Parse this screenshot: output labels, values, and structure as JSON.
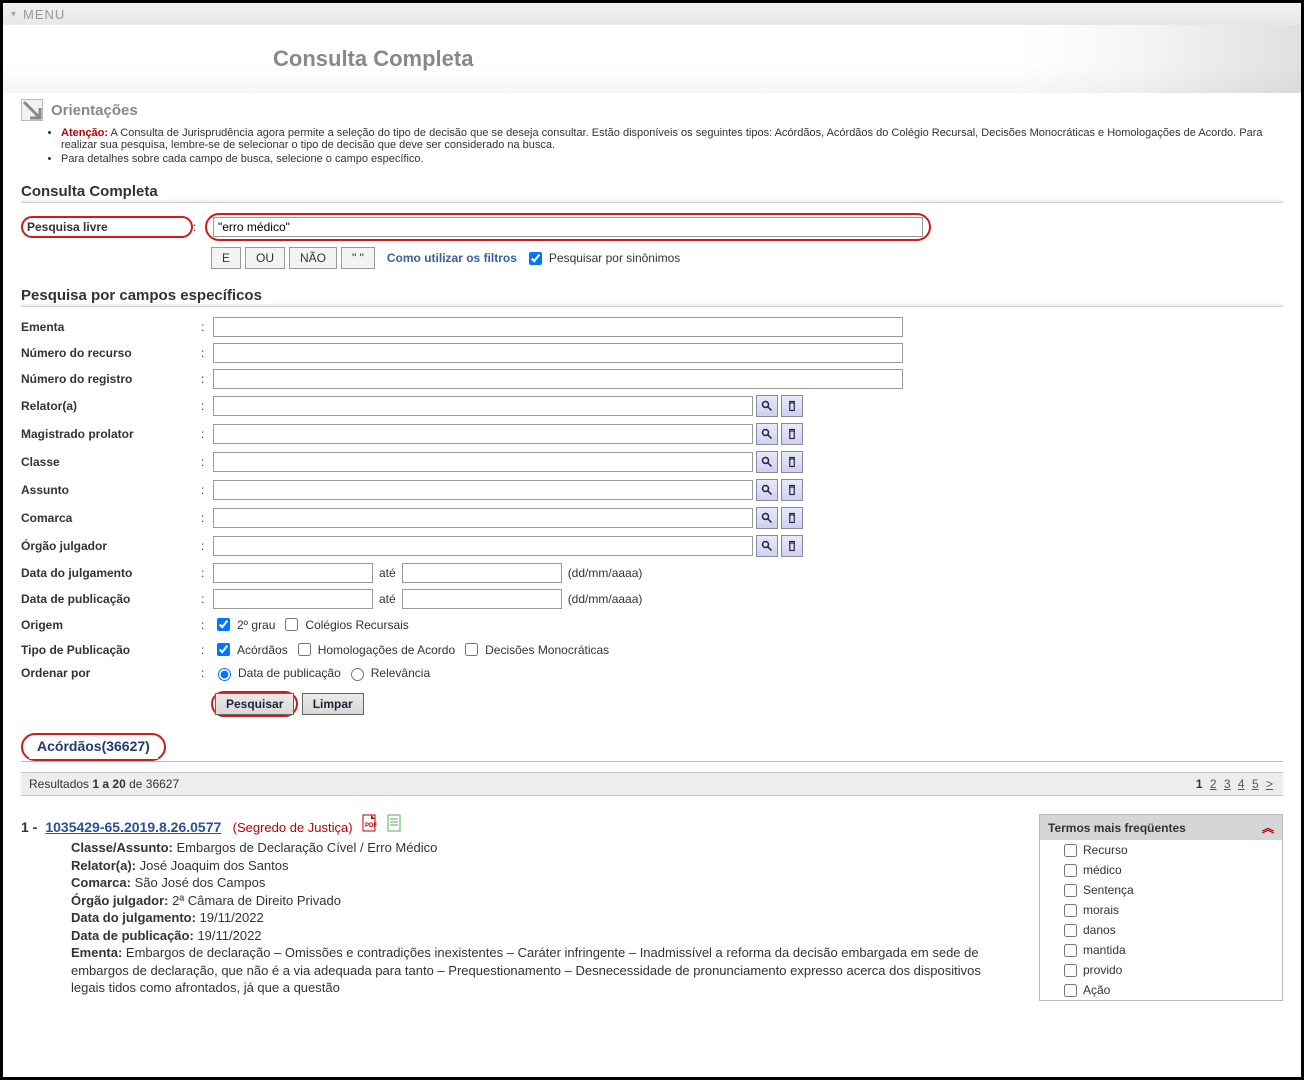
{
  "topbar_menu": "MENU",
  "page_title": "Consulta Completa",
  "orientacoes": {
    "heading": "Orientações",
    "atencao_label": "Atenção:",
    "atencao_text": "A Consulta de Jurisprudência agora permite a seleção do tipo de decisão que se deseja consultar. Estão disponíveis os seguintes tipos: Acórdãos, Acórdãos do Colégio Recursal, Decisões Monocráticas e Homologações de Acordo. Para realizar sua pesquisa, lembre-se de selecionar o tipo de decisão que deve ser considerado na busca.",
    "detail_text": "Para detalhes sobre cada campo de busca, selecione o campo específico."
  },
  "sections": {
    "consulta_completa": "Consulta Completa",
    "campos_especificos": "Pesquisa por campos específicos"
  },
  "labels": {
    "pesquisa_livre": "Pesquisa livre",
    "ementa": "Ementa",
    "numero_recurso": "Número do recurso",
    "numero_registro": "Número do registro",
    "relator": "Relator(a)",
    "magistrado": "Magistrado prolator",
    "classe": "Classe",
    "assunto": "Assunto",
    "comarca": "Comarca",
    "orgao_julgador": "Órgão julgador",
    "data_julgamento": "Data do julgamento",
    "data_publicacao": "Data de publicação",
    "origem": "Origem",
    "tipo_publicacao": "Tipo de Publicação",
    "ordenar_por": "Ordenar por",
    "ate": "até",
    "date_hint": "(dd/mm/aaaa)"
  },
  "pesquisa_livre_value": "\"erro médico\"",
  "operators": {
    "e": "E",
    "ou": "OU",
    "nao": "NÃO",
    "aspas": "\" \""
  },
  "filter_link": "Como utilizar os filtros",
  "synonym_label": "Pesquisar por sinônimos",
  "origem": {
    "grau2": "2º grau",
    "colegios": "Colégios Recursais"
  },
  "tipo_pub": {
    "acordaos": "Acórdãos",
    "homolog": "Homologações de Acordo",
    "monocrat": "Decisões Monocráticas"
  },
  "ordenar": {
    "data": "Data de publicação",
    "relev": "Relevância"
  },
  "buttons": {
    "pesquisar": "Pesquisar",
    "limpar": "Limpar"
  },
  "tab_label": "Acórdãos(36627)",
  "results_bar": {
    "prefix": "Resultados ",
    "range": "1 a 20",
    "de": " de ",
    "total": "36627"
  },
  "paging": {
    "p1": "1",
    "p2": "2",
    "p3": "3",
    "p4": "4",
    "p5": "5",
    "next": ">"
  },
  "result": {
    "num": "1 -",
    "case_no": "1035429-65.2019.8.26.0577",
    "segredo": "(Segredo de Justiça)",
    "classe_label": "Classe/Assunto:",
    "classe_val": "Embargos de Declaração Cível / Erro Médico",
    "relator_label": "Relator(a):",
    "relator_val": "José Joaquim dos Santos",
    "comarca_label": "Comarca:",
    "comarca_val": "São José dos Campos",
    "orgao_label": "Órgão julgador:",
    "orgao_val": "2ª Câmara de Direito Privado",
    "dj_label": "Data do julgamento:",
    "dj_val": "19/11/2022",
    "dp_label": "Data de publicação:",
    "dp_val": "19/11/2022",
    "ementa_label": "Ementa:",
    "ementa_val": "Embargos de declaração – Omissões e contradições inexistentes – Caráter infringente – Inadmissível a reforma da decisão embargada em sede de embargos de declaração, que não é a via adequada para tanto – Prequestionamento – Desnecessidade de pronunciamento expresso acerca dos dispositivos legais tidos como afrontados, já que a questão"
  },
  "sidebox": {
    "title": "Termos mais freqüentes",
    "items": [
      "Recurso",
      "médico",
      "Sentença",
      "morais",
      "danos",
      "mantida",
      "provido",
      "Ação"
    ]
  }
}
